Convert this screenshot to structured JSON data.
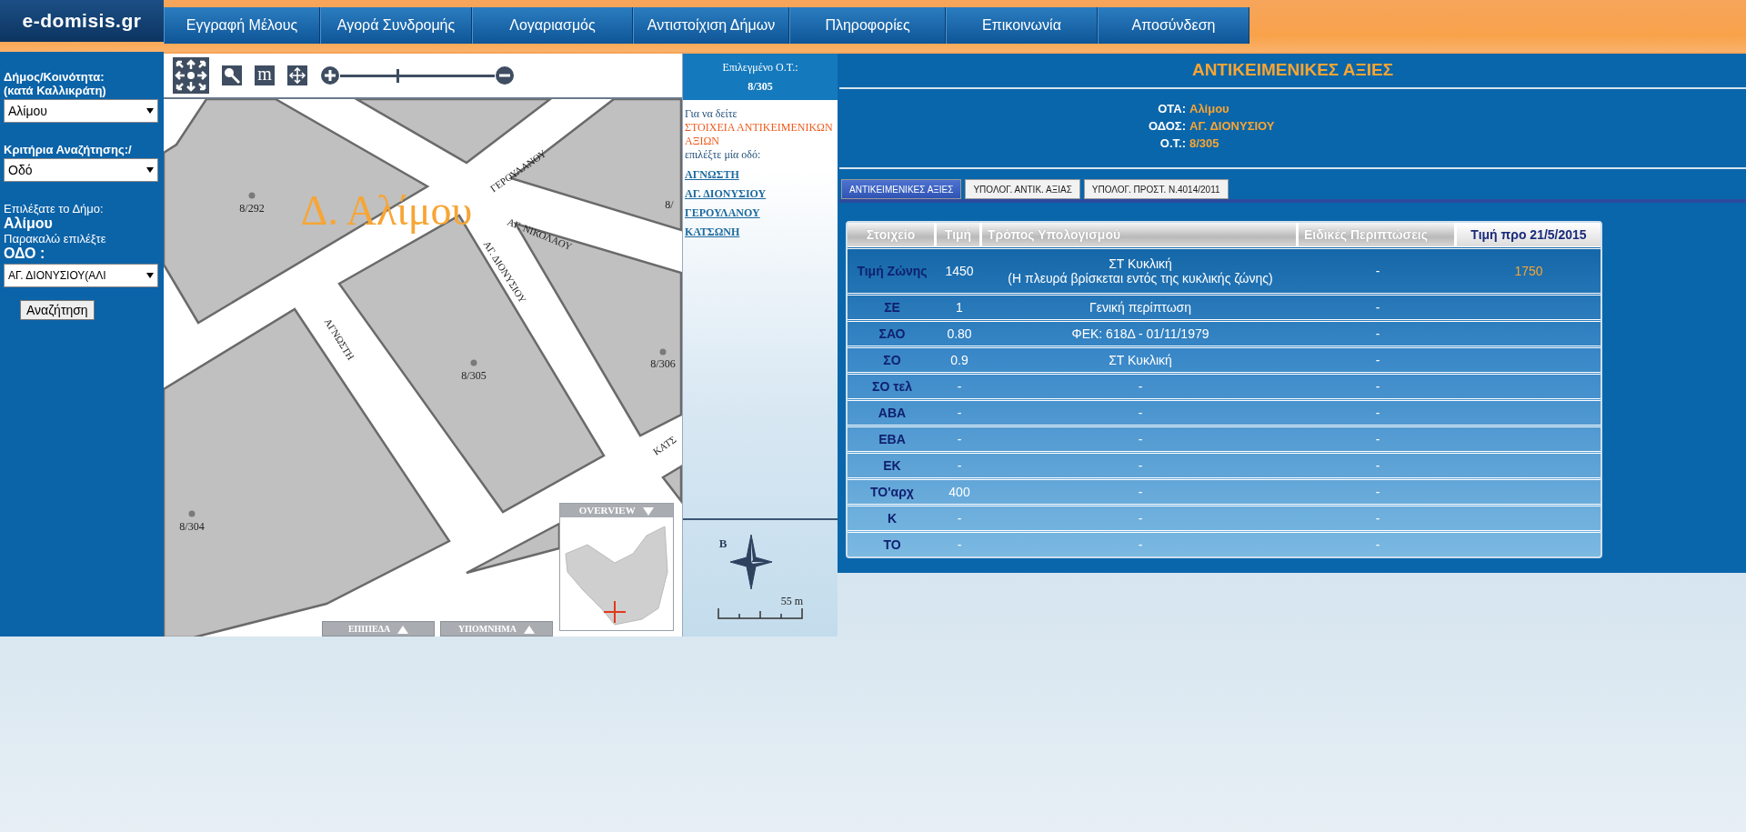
{
  "logo": {
    "text": "e-domisis.gr"
  },
  "nav": [
    {
      "label": "Εγγραφή Μέλους"
    },
    {
      "label": "Αγορά Συνδρομής"
    },
    {
      "label": "Λογαριασμός"
    },
    {
      "label": "Αντιστοίχιση Δήμων"
    },
    {
      "label": "Πληροφορίες"
    },
    {
      "label": "Επικοινωνία"
    },
    {
      "label": "Αποσύνδεση"
    }
  ],
  "sidebar": {
    "municipality_label": [
      "Δήμος/Κοινότητα:",
      "(κατά Καλλικράτη)"
    ],
    "municipality_select": "Αλίμου",
    "criteria_label": "Κριτήρια Αναζήτησης:/",
    "criteria_select": "Οδό",
    "chosen_label": "Επιλέξατε το Δήμο:",
    "chosen_value": "Αλίμου",
    "prompt": "Παρακαλώ επιλέξτε",
    "street_label": "ΟΔΟ :",
    "street_select": "ΑΓ. ΔΙΟΝΥΣΙΟΥ(ΑΛΙ",
    "search_button": "Αναζήτηση"
  },
  "map": {
    "measure_tool": "m",
    "zoom": {
      "level": 0.37
    },
    "watermark": "Δ. Αλίμου",
    "streets": [
      {
        "name": "ΓΕΡΟΥΛΑΝΟΥ"
      },
      {
        "name": "ΑΓ. ΝΙΚΟΛΑΟΥ"
      },
      {
        "name": "ΑΓ. ΔΙΟΝΥΣΙΟΥ"
      },
      {
        "name": "ΑΓΝΩΣΤΗ"
      },
      {
        "name": "ΚΑΤΣ"
      }
    ],
    "blocks": [
      {
        "label": "8/292"
      },
      {
        "label": "8/305"
      },
      {
        "label": "8/306"
      },
      {
        "label": "8/304"
      },
      {
        "label": "8/"
      }
    ],
    "overview": {
      "title": "OVERVIEW"
    },
    "buttons": [
      {
        "label": "ΕΠΙΠΕΔΑ"
      },
      {
        "label": "ΥΠΟΜΝΗΜΑ"
      }
    ]
  },
  "info_panel": {
    "selected_title": "Επιλεγμένο Ο.Τ.:",
    "selected_value": "8/305",
    "intro_before": "Για να δείτε",
    "intro_highlight": "ΣΤΟΙΧΕΙΑ ΑΝΤΙΚΕΙΜΕΝΙΚΩΝ ΑΞΙΩΝ",
    "intro_after": "επιλέξτε μία οδό:",
    "streets": [
      "ΑΓΝΩΣΤΗ",
      "ΑΓ. ΔΙΟΝΥΣΙΟΥ",
      "ΓΕΡΟΥΛΑΝΟΥ",
      "ΚΑΤΣΩΝΗ"
    ],
    "compass_label": "Β",
    "scale_label": "55 m"
  },
  "values": {
    "title": "ΑΝΤΙΚΕΙΜΕΝΙΚΕΣ ΑΞΙΕΣ",
    "details": [
      {
        "label": "ΟΤΑ:",
        "value": "Αλίμου"
      },
      {
        "label": "ΟΔΟΣ:",
        "value": "ΑΓ. ΔΙΟΝΥΣΙΟΥ"
      },
      {
        "label": "Ο.Τ.:",
        "value": "8/305"
      }
    ],
    "tabs": [
      {
        "label": "ΑΝΤΙΚΕΙΜΕΝΙΚΕΣ ΑΞΙΕΣ",
        "selected": true
      },
      {
        "label": "ΥΠΟΛΟΓ. ΑΝΤΙΚ. ΑΞΙΑΣ",
        "selected": false
      },
      {
        "label": "ΥΠΟΛΟΓ. ΠΡΟΣΤ. Ν.4014/2011",
        "selected": false
      }
    ],
    "table": {
      "columns": [
        "Στοιχείο",
        "Τιμή",
        "Τρόπος Υπολογισμού",
        "Ειδικές Περιπτώσεις",
        "Τιμή προ 21/5/2015"
      ],
      "rows": [
        {
          "item": "Τιμή Ζώνης",
          "value": "1450",
          "method": [
            "ΣΤ Κυκλική",
            "(Η πλευρά βρίσκεται εντός της κυκλικής ζώνης)"
          ],
          "special": "-",
          "before": "1750"
        },
        {
          "item": "ΣΕ",
          "value": "1",
          "method": [
            "Γενική περίπτωση"
          ],
          "special": "-"
        },
        {
          "item": "ΣΑΟ",
          "value": "0.80",
          "method": [
            "ΦΕΚ: 618Δ - 01/11/1979"
          ],
          "special": "-"
        },
        {
          "item": "ΣΟ",
          "value": "0.9",
          "method": [
            "ΣΤ Κυκλική"
          ],
          "special": "-"
        },
        {
          "item": "ΣΟ τελ",
          "value": "-",
          "method": [
            "-"
          ],
          "special": "-"
        },
        {
          "item": "ΑΒΑ",
          "value": "-",
          "method": [
            "-"
          ],
          "special": "-"
        },
        {
          "item": "ΕΒΑ",
          "value": "-",
          "method": [
            "-"
          ],
          "special": "-"
        },
        {
          "item": "ΕΚ",
          "value": "-",
          "method": [
            "-"
          ],
          "special": "-"
        },
        {
          "item": "ΤΟ'αρχ",
          "value": "400",
          "method": [
            "-"
          ],
          "special": "-"
        },
        {
          "item": "Κ",
          "value": "-",
          "method": [
            "-"
          ],
          "special": "-"
        },
        {
          "item": "ΤΟ",
          "value": "-",
          "method": [
            "-"
          ],
          "special": "-"
        }
      ]
    }
  }
}
